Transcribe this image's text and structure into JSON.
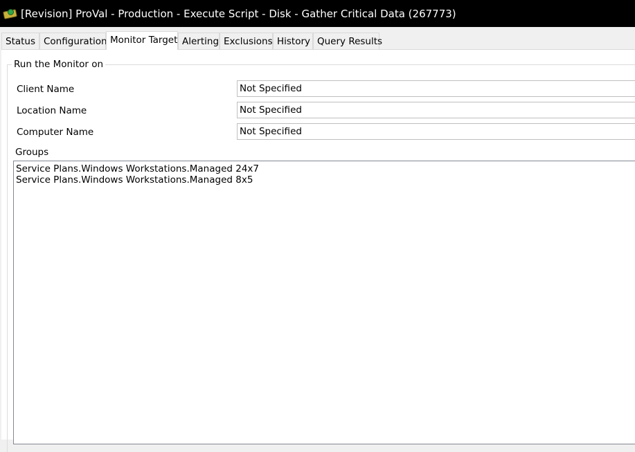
{
  "window": {
    "title": "[Revision] ProVal - Production - Execute Script - Disk - Gather Critical Data (267773)"
  },
  "tabs": [
    {
      "label": "Status"
    },
    {
      "label": "Configuration"
    },
    {
      "label": "Monitor Target"
    },
    {
      "label": "Alerting"
    },
    {
      "label": "Exclusions"
    },
    {
      "label": "History"
    },
    {
      "label": "Query Results"
    }
  ],
  "active_tab": "Monitor Target",
  "monitor_target": {
    "group_title": "Run the Monitor on",
    "fields": [
      {
        "label": "Client Name",
        "value": "Not Specified"
      },
      {
        "label": "Location Name",
        "value": "Not Specified"
      },
      {
        "label": "Computer Name",
        "value": "Not Specified"
      }
    ],
    "groups_label": "Groups",
    "groups": [
      "Service Plans.Windows Workstations.Managed 24x7",
      "Service Plans.Windows Workstations.Managed 8x5"
    ]
  }
}
